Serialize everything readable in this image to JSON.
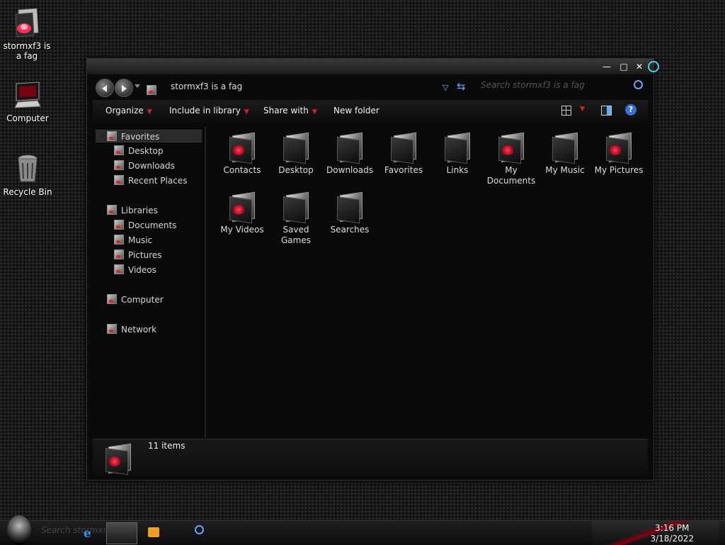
{
  "desktop": {
    "icons": [
      {
        "label": "stormxf3 is a fag",
        "icon": "user-folder-icon"
      },
      {
        "label": "Computer",
        "icon": "computer-icon"
      },
      {
        "label": "Recycle Bin",
        "icon": "recycle-bin-icon"
      }
    ]
  },
  "window": {
    "caption": {
      "minimize": "—",
      "maximize": "□",
      "close": "✕"
    },
    "address": {
      "path": "stormxf3 is a fag"
    },
    "search": {
      "placeholder": "Search stormxf3 is a fag"
    },
    "toolbar": {
      "organize": "Organize",
      "include_in_library": "Include in library",
      "share_with": "Share with",
      "new_folder": "New folder",
      "help": "?"
    },
    "nav": {
      "favorites": "Favorites",
      "favorites_items": [
        "Desktop",
        "Downloads",
        "Recent Places"
      ],
      "libraries": "Libraries",
      "libraries_items": [
        "Documents",
        "Music",
        "Pictures",
        "Videos"
      ],
      "computer": "Computer",
      "network": "Network"
    },
    "items": [
      {
        "label": "Contacts"
      },
      {
        "label": "Desktop"
      },
      {
        "label": "Downloads"
      },
      {
        "label": "Favorites"
      },
      {
        "label": "Links"
      },
      {
        "label": "My Documents"
      },
      {
        "label": "My Music"
      },
      {
        "label": "My Pictures"
      },
      {
        "label": "My Videos"
      },
      {
        "label": "Saved Games"
      },
      {
        "label": "Searches"
      }
    ],
    "status": {
      "count": "11 items"
    }
  },
  "taskbar": {
    "search_placeholder": "Search stormxf3 is a fag",
    "time": "3:16 PM",
    "date": "3/18/2022"
  },
  "colors": {
    "accent": "#d01020",
    "window_bg": "#0a0a0a"
  }
}
